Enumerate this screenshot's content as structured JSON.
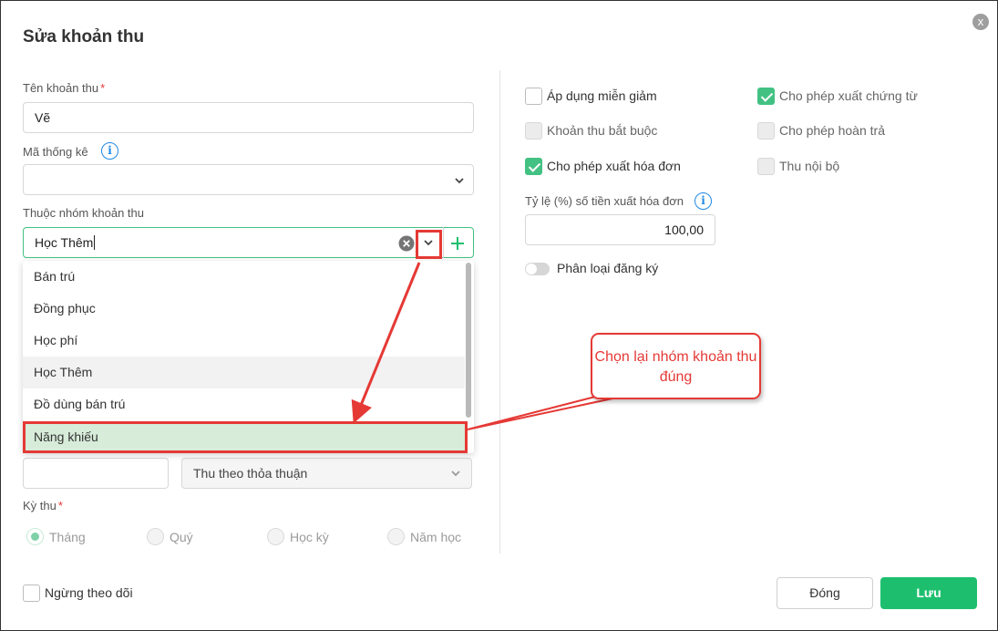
{
  "dialog": {
    "title": "Sửa khoản thu",
    "close_icon": "x"
  },
  "left": {
    "name_label": "Tên khoản thu",
    "required_mark": "*",
    "name_value": "Vẽ",
    "stat_code_label": "Mã thống kê",
    "stat_code_value": "",
    "info_glyph": "i",
    "group_label": "Thuộc nhóm khoản thu",
    "group_value": "Học Thêm",
    "group_options": [
      "Bán trú",
      "Đồng phục",
      "Học phí",
      "Học Thêm",
      "Đồ dùng bán trú",
      "Năng khiếu"
    ],
    "amount_value": "",
    "collection_method": "Thu theo thỏa thuận",
    "period_label": "Kỳ thu",
    "periods": [
      "Tháng",
      "Quý",
      "Học kỳ",
      "Năm học"
    ],
    "period_selected": "Tháng",
    "stop_tracking_label": "Ngừng theo dõi"
  },
  "right": {
    "options": [
      {
        "label": "Áp dụng miễn giảm",
        "checked": false,
        "disabled": false
      },
      {
        "label": "Cho phép xuất chứng từ",
        "checked": true,
        "disabled": false
      },
      {
        "label": "Khoản thu bắt buộc",
        "checked": false,
        "disabled": true
      },
      {
        "label": "Cho phép hoàn trả",
        "checked": false,
        "disabled": true
      },
      {
        "label": "Cho phép xuất hóa đơn",
        "checked": true,
        "disabled": false
      },
      {
        "label": "Thu nội bộ",
        "checked": false,
        "disabled": true
      }
    ],
    "invoice_ratio_label": "Tỷ lệ (%) số tiền xuất hóa đơn",
    "invoice_ratio_value": "100,00",
    "registration_toggle_label": "Phân loại đăng ký",
    "registration_toggle_on": false
  },
  "buttons": {
    "close": "Đóng",
    "save": "Lưu"
  },
  "annotation": {
    "callout_text": "Chọn lại nhóm khoản thu đúng",
    "color": "#e53935"
  },
  "colors": {
    "accent_green": "#1dbf6e",
    "check_green": "#43c183",
    "info_blue": "#1e88e5"
  }
}
